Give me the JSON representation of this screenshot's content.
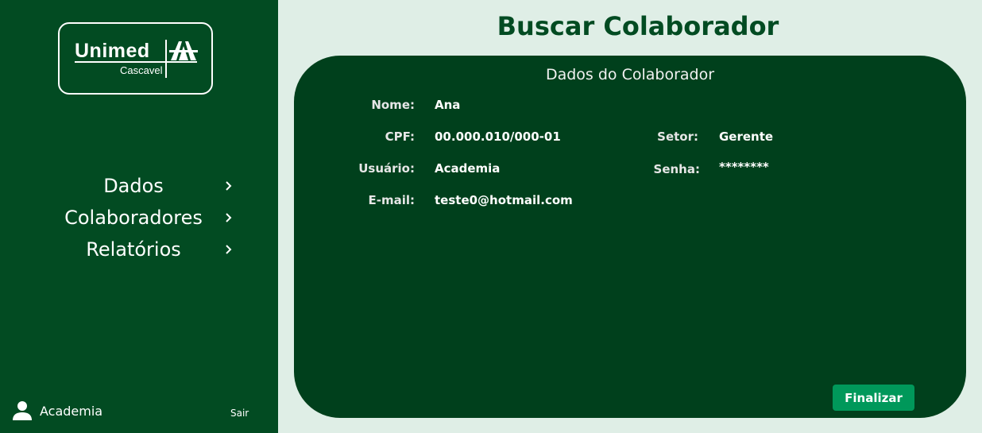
{
  "logo": {
    "brand": "Unimed",
    "city": "Cascavel"
  },
  "nav": {
    "items": [
      {
        "label": "Dados",
        "icon": "chevron-right-icon"
      },
      {
        "label": "Colaboradores",
        "icon": "chevron-right-icon"
      },
      {
        "label": "Relatórios",
        "icon": "chevron-right-icon"
      }
    ]
  },
  "user": {
    "name": "Academia",
    "icon": "user-icon",
    "logout_label": "Sair"
  },
  "page": {
    "title": "Buscar Colaborador"
  },
  "card": {
    "title": "Dados do Colaborador",
    "fields": {
      "nome_label": "Nome:",
      "nome_value": "Ana",
      "cpf_label": "CPF:",
      "cpf_value": "00.000.010/000-01",
      "usuario_label": "Usuário:",
      "usuario_value": "Academia",
      "email_label": "E-mail:",
      "email_value": "teste0@hotmail.com",
      "setor_label": "Setor:",
      "setor_value": "Gerente",
      "senha_label": "Senha:",
      "senha_value": "********"
    },
    "finish_label": "Finalizar"
  },
  "colors": {
    "sidebar": "#024b22",
    "card": "#00401c",
    "background": "#dfeee6",
    "button": "#00985a",
    "title": "#024b22"
  }
}
